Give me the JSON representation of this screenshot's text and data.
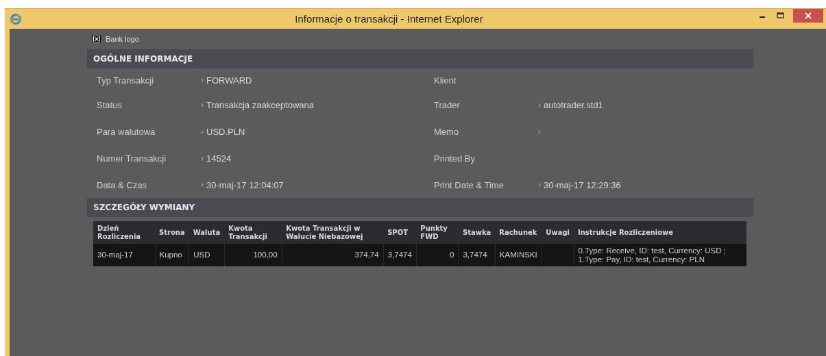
{
  "window": {
    "title": "Informacje o transakcji - Internet Explorer"
  },
  "logo": {
    "alt_text": "Bank logo"
  },
  "general": {
    "heading": "OGÓLNE INFORMACJE",
    "left": [
      {
        "label": "Typ Transakcji",
        "arrow": true,
        "value": "FORWARD"
      },
      {
        "label": "Status",
        "arrow": true,
        "value": "Transakcja zaakceptowana"
      },
      {
        "label": "Para walutowa",
        "arrow": true,
        "value": "USD.PLN"
      },
      {
        "label": "Numer Transakcji",
        "arrow": true,
        "value": "14524"
      },
      {
        "label": "Data & Czas",
        "arrow": true,
        "value": "30-maj-17 12:04:07"
      }
    ],
    "right": [
      {
        "label": "Klient",
        "arrow": false
      },
      {
        "label": "Trader",
        "arrow": true,
        "value": "autotrader.std1"
      },
      {
        "label": "Memo",
        "arrow": true
      },
      {
        "label": "Printed By",
        "arrow": false
      },
      {
        "label": "Print Date & Time",
        "arrow": true,
        "value": "30-maj-17 12:29:36"
      }
    ]
  },
  "details": {
    "heading": "SZCZEGÓŁY WYMIANY",
    "table": {
      "columns": [
        "Dzień Rozliczenia",
        "Strona",
        "Waluta",
        "Kwota Transakcji",
        "Kwota Transakcji w Walucie Niebazowej",
        "SPOT",
        "Punkty FWD",
        "Stawka",
        "Rachunek",
        "Uwagi",
        "Instrukcje Rozliczeniowe"
      ],
      "rows": [
        [
          "30-maj-17",
          "Kupno",
          "USD",
          "100,00",
          "374,74",
          "3,7474",
          "0",
          "3,7474",
          "KAMINSKI",
          "",
          "0.Type: Receive, ID: test, Currency: USD ; 1.Type: Pay, ID: test, Currency: PLN"
        ]
      ]
    }
  }
}
